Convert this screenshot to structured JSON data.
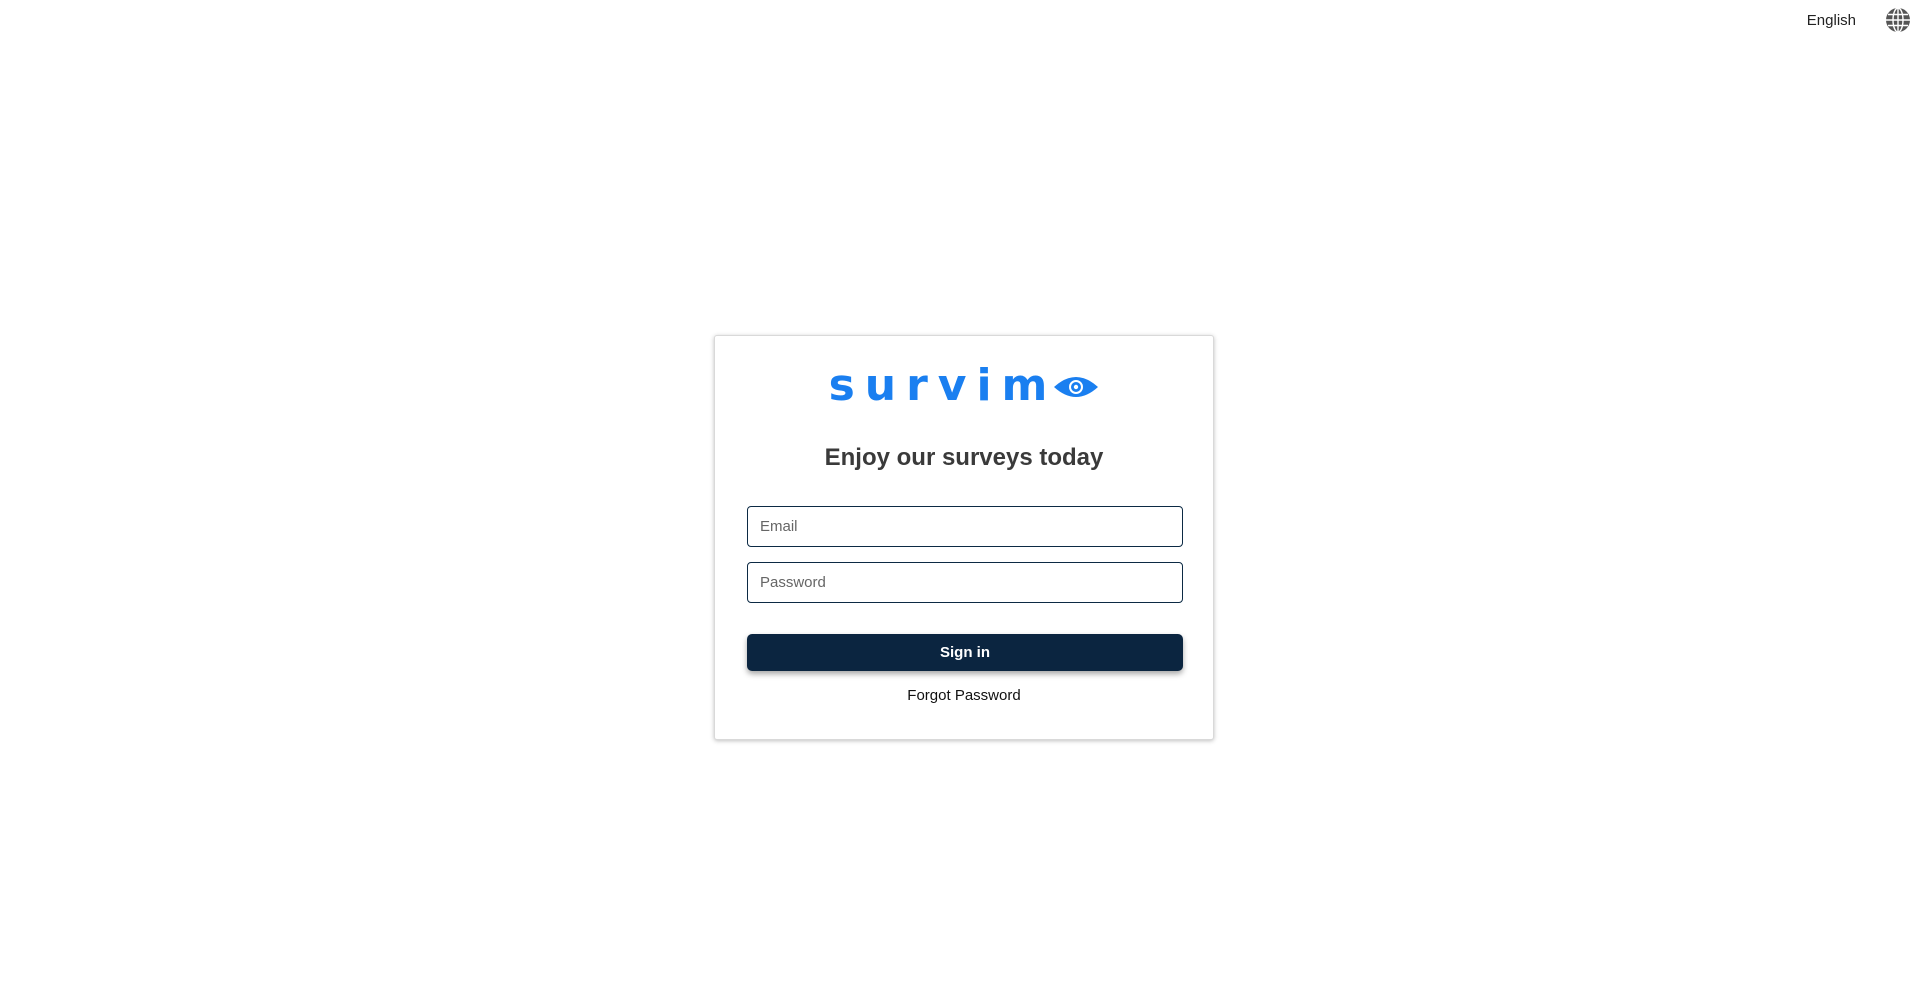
{
  "header": {
    "language_label": "English",
    "language_icon": "globe-icon"
  },
  "login": {
    "logo_text": "survim",
    "logo_icon": "eye-icon",
    "brand_color": "#1a7ff0",
    "heading": "Enjoy our surveys today",
    "email": {
      "placeholder": "Email",
      "value": ""
    },
    "password": {
      "placeholder": "Password",
      "value": ""
    },
    "signin_label": "Sign in",
    "signin_color": "#0b2540",
    "forgot_label": "Forgot Password"
  }
}
